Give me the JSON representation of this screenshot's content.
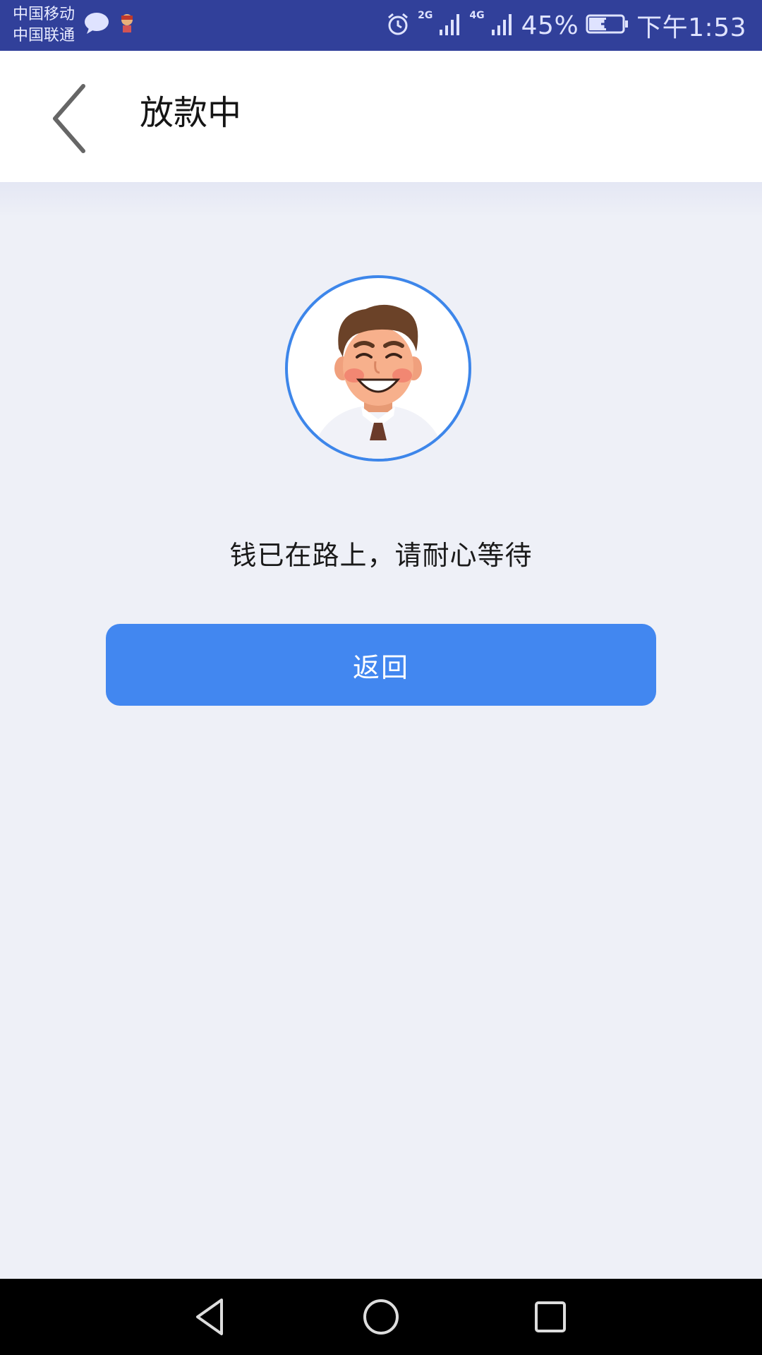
{
  "status_bar": {
    "carrier_1": "中国移动",
    "carrier_2": "中国联通",
    "signal_1_label": "2G",
    "signal_2_label": "4G",
    "battery": "45%",
    "time": "下午1:53",
    "icons": [
      "message-bubble-icon",
      "app-notification-icon",
      "alarm-icon",
      "signal-icon",
      "battery-charging-icon"
    ]
  },
  "header": {
    "title": "放款中",
    "back_icon": "chevron-left-icon"
  },
  "main": {
    "avatar_icon": "smiling-man-avatar",
    "message": "钱已在路上，请耐心等待",
    "return_label": "返回"
  },
  "colors": {
    "status_bar": "#31409a",
    "background": "#eef0f7",
    "accent": "#4287f0",
    "avatar_ring": "#3d86ea"
  },
  "nav_bar": {
    "icons": [
      "nav-back-icon",
      "nav-home-icon",
      "nav-recent-icon"
    ]
  }
}
